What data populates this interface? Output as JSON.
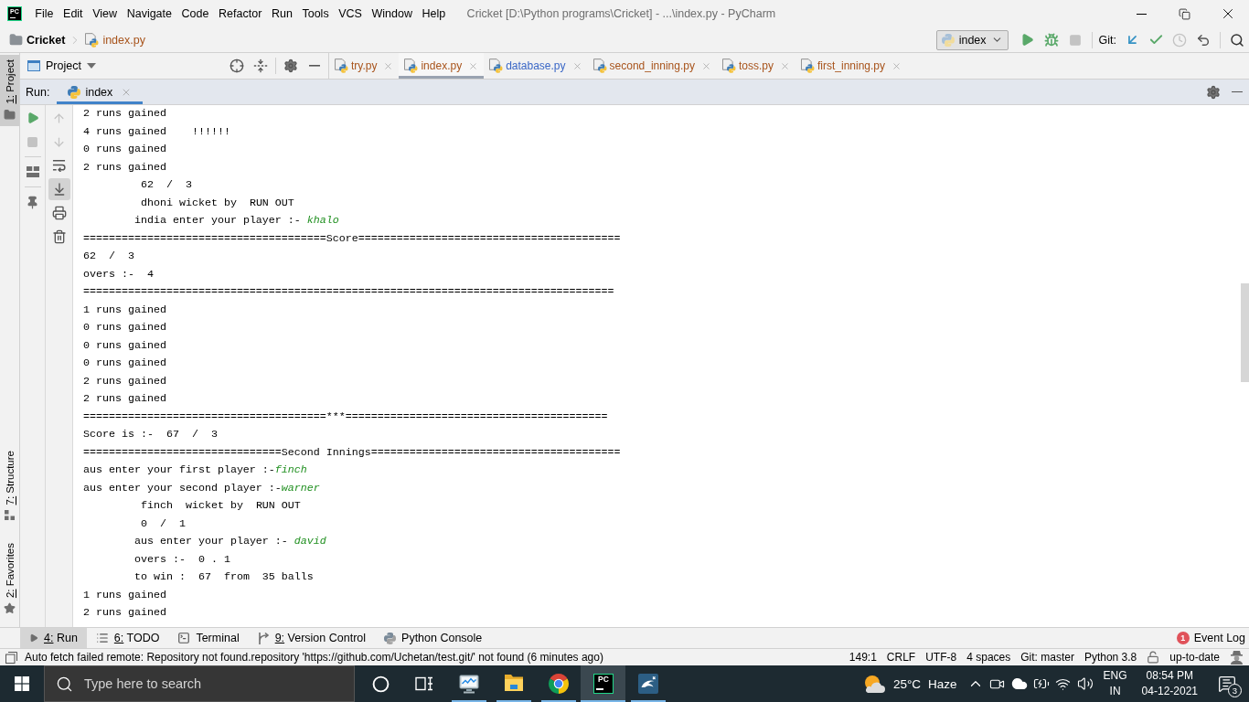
{
  "title_bar": {
    "logo": "PC",
    "menu": [
      "File",
      "Edit",
      "View",
      "Navigate",
      "Code",
      "Refactor",
      "Run",
      "Tools",
      "VCS",
      "Window",
      "Help"
    ],
    "title": "Cricket [D:\\Python programs\\Cricket] - ...\\index.py - PyCharm"
  },
  "nav_bar": {
    "breadcrumb": [
      {
        "kind": "folder",
        "label": "Cricket"
      },
      {
        "kind": "file",
        "label": "index.py",
        "color": "#a8541c"
      }
    ],
    "run_config": "index",
    "actions": [
      {
        "kind": "run",
        "disabled": false
      },
      {
        "kind": "debug",
        "disabled": false
      },
      {
        "kind": "stop",
        "disabled": true
      }
    ],
    "vcs_label": "Git:",
    "vcs_actions": [
      {
        "kind": "update",
        "disabled": false
      },
      {
        "kind": "commit",
        "disabled": false
      },
      {
        "kind": "history",
        "disabled": true
      },
      {
        "kind": "rollback",
        "disabled": false
      }
    ]
  },
  "side_strip": [
    {
      "kind": "project",
      "label": "1: Project",
      "mnemonic": true,
      "selected": true
    },
    {
      "kind": "structure",
      "label": "7: Structure",
      "mnemonic": true,
      "selected": false
    },
    {
      "kind": "favorites",
      "label": "2: Favorites",
      "mnemonic": true,
      "selected": false
    }
  ],
  "project_panel": {
    "title": "Project"
  },
  "editor_tabs": [
    {
      "label": "try.py",
      "selected": false,
      "color": "#a8541c"
    },
    {
      "label": "index.py",
      "selected": true,
      "color": "#a8541c"
    },
    {
      "label": "database.py",
      "selected": false,
      "color": "#3a67c6"
    },
    {
      "label": "second_inning.py",
      "selected": false,
      "color": "#a8541c"
    },
    {
      "label": "toss.py",
      "selected": false,
      "color": "#a8541c"
    },
    {
      "label": "first_inning.py",
      "selected": false,
      "color": "#a8541c"
    }
  ],
  "run_panel": {
    "label": "Run:",
    "tabs": [
      {
        "label": "index",
        "selected": true
      }
    ],
    "run_toolbar": [
      {
        "kind": "rerun",
        "disabled": false
      },
      {
        "kind": "stop",
        "disabled": true
      },
      {
        "kind": "layout",
        "disabled": false
      },
      {
        "kind": "pin",
        "disabled": false
      }
    ],
    "console_toolbar": [
      {
        "kind": "up",
        "disabled": true,
        "on": false
      },
      {
        "kind": "down",
        "disabled": true,
        "on": false
      },
      {
        "kind": "wrap",
        "disabled": false,
        "on": false
      },
      {
        "kind": "scroll_end",
        "disabled": false,
        "on": true
      },
      {
        "kind": "print",
        "disabled": false,
        "on": false
      },
      {
        "kind": "clear",
        "disabled": false,
        "on": false
      }
    ],
    "console": [
      {
        "text": "2 runs gained"
      },
      {
        "text": "4 runs gained    !!!!!!"
      },
      {
        "text": "0 runs gained"
      },
      {
        "text": "2 runs gained"
      },
      {
        "text": "         62  /  3"
      },
      {
        "text": "         dhoni wicket by  RUN OUT"
      },
      {
        "text": "        india enter your player :- ",
        "input": "khalo"
      },
      {
        "text": "======================================Score========================================="
      },
      {
        "text": "62  /  3"
      },
      {
        "text": "overs :-  4"
      },
      {
        "text": "==================================================================================="
      },
      {
        "text": "1 runs gained"
      },
      {
        "text": "0 runs gained"
      },
      {
        "text": "0 runs gained"
      },
      {
        "text": "0 runs gained"
      },
      {
        "text": "2 runs gained"
      },
      {
        "text": "2 runs gained"
      },
      {
        "text": "======================================***========================================="
      },
      {
        "text": "Score is :-  67  /  3"
      },
      {
        "text": "===============================Second Innings======================================="
      },
      {
        "text": "aus enter your first player :-",
        "input": "finch"
      },
      {
        "text": "aus enter your second player :-",
        "input": "warner"
      },
      {
        "text": "         finch  wicket by  RUN OUT"
      },
      {
        "text": "         0  /  1"
      },
      {
        "text": "        aus enter your player :- ",
        "input": "david"
      },
      {
        "text": "        overs :-  0 . 1"
      },
      {
        "text": "        to win :  67  from  35 balls"
      },
      {
        "text": "1 runs gained"
      },
      {
        "text": "2 runs gained"
      }
    ]
  },
  "bottom_tools": [
    {
      "kind": "run",
      "label": "4: Run",
      "mnemonic": true,
      "selected": true
    },
    {
      "kind": "todo",
      "label": "6: TODO",
      "mnemonic": true,
      "selected": false
    },
    {
      "kind": "terminal",
      "label": "Terminal",
      "mnemonic": false,
      "selected": false
    },
    {
      "kind": "vcs",
      "label": "9: Version Control",
      "mnemonic": true,
      "selected": false
    },
    {
      "kind": "python",
      "label": "Python Console",
      "mnemonic": false,
      "selected": false
    }
  ],
  "event_log": {
    "count": "1",
    "label": "Event Log"
  },
  "status_bar": {
    "message": "Auto fetch failed remote: Repository not found.repository 'https://github.com/Uchetan/test.git/' not found (6 minutes ago)",
    "items": [
      "149:1",
      "CRLF",
      "UTF-8",
      "4 spaces",
      "Git: master",
      "Python 3.8"
    ],
    "vcs_status": "up-to-date"
  },
  "taskbar": {
    "search": {
      "placeholder": "Type here to search"
    },
    "apps": [
      {
        "kind": "monitor",
        "running": true,
        "selected": false
      },
      {
        "kind": "explorer",
        "running": true,
        "selected": false
      },
      {
        "kind": "browser",
        "running": true,
        "selected": false
      },
      {
        "kind": "ide",
        "label": "PC",
        "running": true,
        "selected": true
      },
      {
        "kind": "database",
        "running": true,
        "selected": false
      }
    ],
    "weather": {
      "temperature": "25°C",
      "condition": "Haze"
    },
    "language": "ENG",
    "region": "IN",
    "time": "08:54 PM",
    "date": "04-12-2021",
    "notification_count": "3"
  }
}
